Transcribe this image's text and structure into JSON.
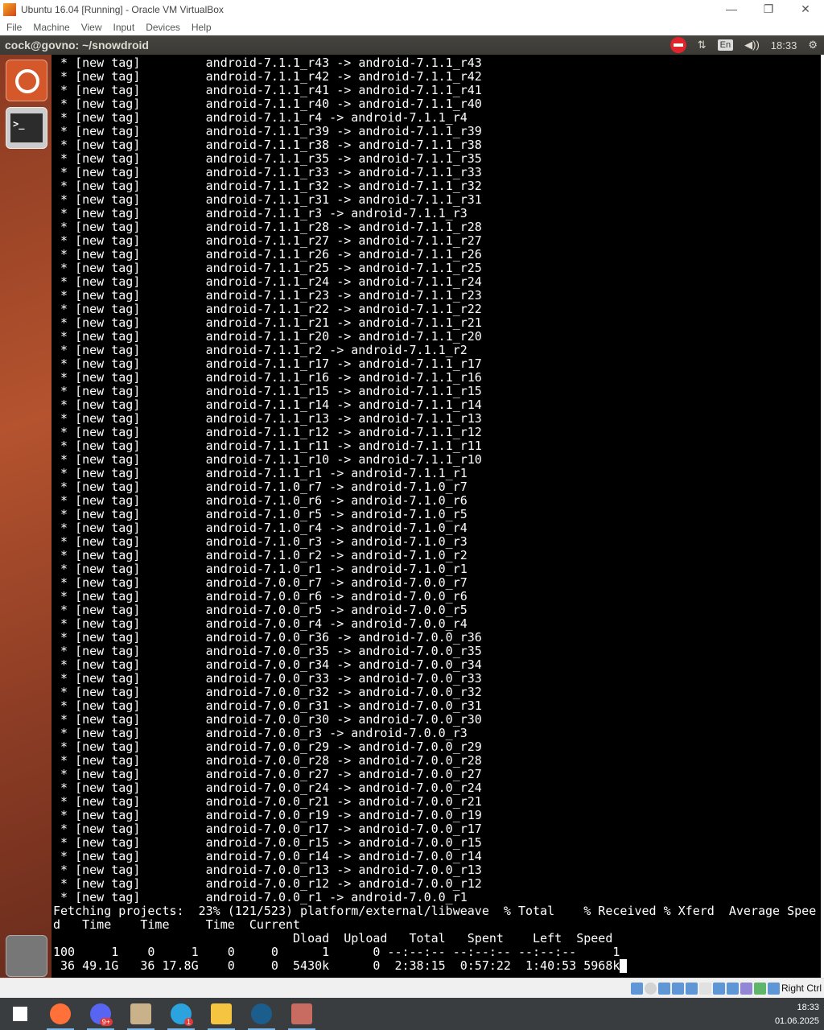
{
  "window": {
    "title": "Ubuntu 16.04 [Running] - Oracle VM VirtualBox",
    "minimize": "—",
    "maximize": "❐",
    "close": "✕"
  },
  "menu": [
    "File",
    "Machine",
    "View",
    "Input",
    "Devices",
    "Help"
  ],
  "panel": {
    "title": "cock@govno: ~/snowdroid",
    "lang": "En",
    "time": "18:33",
    "network": "⇅",
    "volume": "◀))",
    "gear": "⚙"
  },
  "terminal": {
    "tag_prefix": " * [new tag]         ",
    "tags": [
      "android-7.1.1_r43",
      "android-7.1.1_r42",
      "android-7.1.1_r41",
      "android-7.1.1_r40",
      "android-7.1.1_r4",
      "android-7.1.1_r39",
      "android-7.1.1_r38",
      "android-7.1.1_r35",
      "android-7.1.1_r33",
      "android-7.1.1_r32",
      "android-7.1.1_r31",
      "android-7.1.1_r3",
      "android-7.1.1_r28",
      "android-7.1.1_r27",
      "android-7.1.1_r26",
      "android-7.1.1_r25",
      "android-7.1.1_r24",
      "android-7.1.1_r23",
      "android-7.1.1_r22",
      "android-7.1.1_r21",
      "android-7.1.1_r20",
      "android-7.1.1_r2",
      "android-7.1.1_r17",
      "android-7.1.1_r16",
      "android-7.1.1_r15",
      "android-7.1.1_r14",
      "android-7.1.1_r13",
      "android-7.1.1_r12",
      "android-7.1.1_r11",
      "android-7.1.1_r10",
      "android-7.1.1_r1",
      "android-7.1.0_r7",
      "android-7.1.0_r6",
      "android-7.1.0_r5",
      "android-7.1.0_r4",
      "android-7.1.0_r3",
      "android-7.1.0_r2",
      "android-7.1.0_r1",
      "android-7.0.0_r7",
      "android-7.0.0_r6",
      "android-7.0.0_r5",
      "android-7.0.0_r4",
      "android-7.0.0_r36",
      "android-7.0.0_r35",
      "android-7.0.0_r34",
      "android-7.0.0_r33",
      "android-7.0.0_r32",
      "android-7.0.0_r31",
      "android-7.0.0_r30",
      "android-7.0.0_r3",
      "android-7.0.0_r29",
      "android-7.0.0_r28",
      "android-7.0.0_r27",
      "android-7.0.0_r24",
      "android-7.0.0_r21",
      "android-7.0.0_r19",
      "android-7.0.0_r17",
      "android-7.0.0_r15",
      "android-7.0.0_r14",
      "android-7.0.0_r13",
      "android-7.0.0_r12",
      "android-7.0.0_r1"
    ],
    "tail": [
      "Fetching projects:  23% (121/523) platform/external/libweave  % Total    % Received % Xferd  Average Spee",
      "d   Time    Time     Time  Current",
      "                                 Dload  Upload   Total   Spent    Left  Speed",
      "100     1    0     1    0     0      1      0 --:--:-- --:--:-- --:--:--     1",
      " 36 49.1G   36 17.8G    0     0  5430k      0  2:38:15  0:57:22  1:40:53 5968k"
    ]
  },
  "statusbar": {
    "host_key": "Right Ctrl"
  },
  "taskbar": {
    "apps": [
      {
        "name": "start",
        "badge": null,
        "color": "#ffffff"
      },
      {
        "name": "firefox",
        "badge": null,
        "color": "#ff7139"
      },
      {
        "name": "discord",
        "badge": "9+",
        "color": "#5865f2"
      },
      {
        "name": "archive-app",
        "badge": null,
        "color": "#c9b28a"
      },
      {
        "name": "telegram",
        "badge": "1",
        "color": "#2aa3df"
      },
      {
        "name": "file-explorer",
        "badge": null,
        "color": "#f5c542"
      },
      {
        "name": "steam",
        "badge": null,
        "color": "#1b5d8c"
      },
      {
        "name": "virtualbox-vm",
        "badge": null,
        "color": "#c86b60"
      }
    ],
    "time": "18:33",
    "date": "01.06.2025"
  }
}
